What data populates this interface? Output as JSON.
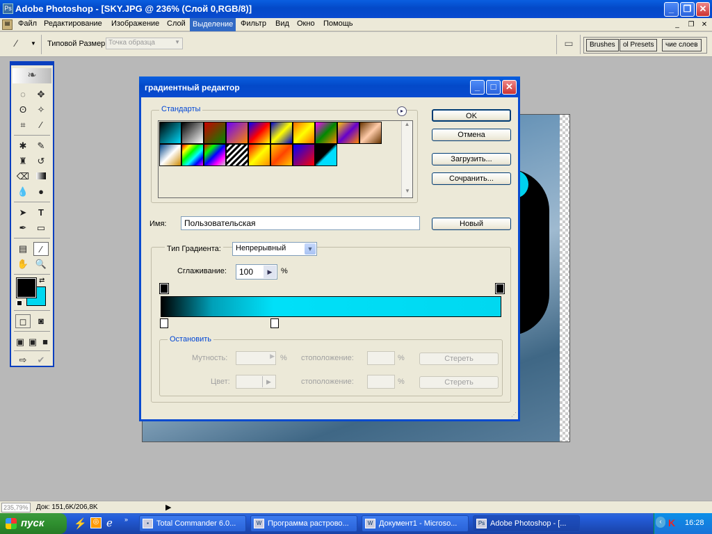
{
  "window": {
    "title": "Adobe Photoshop - [SKY.JPG @ 236% (Слой 0,RGB/8)]",
    "app_icon": "photoshop-icon"
  },
  "menu": [
    "Файл",
    "Редактирование",
    "Изображение",
    "Слой",
    "Выделение",
    "Фильтр",
    "Вид",
    "Окно",
    "Помощь"
  ],
  "menu_selected": "Выделение",
  "options_bar": {
    "label": "Типовой Размер:",
    "sample_value": "Точка образца",
    "palette_tabs": [
      "Brushes",
      "ol Presets",
      "чие слоев"
    ]
  },
  "dialog": {
    "title": "градиентный редактор",
    "presets_label": "Стандарты",
    "buttons": {
      "ok": "OK",
      "cancel": "Отмена",
      "load": "Загрузить...",
      "save": "Сочранить...",
      "new": "Новый"
    },
    "name_label": "Имя:",
    "name_value": "Пользовательская",
    "gradient_type_label": "Тип Градиента:",
    "gradient_type_value": "Непрерывный",
    "smoothness_label": "Сглаживание:",
    "smoothness_value": "100",
    "percent": "%",
    "stops_label": "Остановить",
    "opacity_label": "Мутность:",
    "location_label": "стоположение:",
    "color_label": "Цвет:",
    "delete_label": "Стереть",
    "gradient_colors": [
      "#000000",
      "#00a0b8",
      "#00e0f8",
      "#00d8f0"
    ]
  },
  "presets": [
    "linear-gradient(135deg,#000,#00d8f8)",
    "linear-gradient(135deg,#000,#fff)",
    "linear-gradient(135deg,#c00,#080)",
    "linear-gradient(135deg,#60f,#f80)",
    "linear-gradient(135deg,#00f,#f00,#ff0)",
    "linear-gradient(135deg,#00c,#ff0,#00c)",
    "linear-gradient(135deg,#f60,#ff0,#f60)",
    "linear-gradient(135deg,#f0f,#080,#f80)",
    "linear-gradient(135deg,#fc0,#60c,#f80)",
    "linear-gradient(135deg,#630,#fca,#630)",
    "linear-gradient(135deg,#048,#fff,#c80)",
    "linear-gradient(135deg,#f00,#ff0,#0f0,#0ff,#00f,#f0f)",
    "linear-gradient(135deg,#f00,#0f0,#00f,#f0f,#ccc)",
    "repeating-linear-gradient(135deg,#000 0 3px,#fff 3px 6px)",
    "linear-gradient(135deg,#f00,#ff0,#f80)",
    "linear-gradient(135deg,#fc0,#f40,#fc0)",
    "linear-gradient(135deg,#00f,#f00)",
    "linear-gradient(135deg,#000 45%,#0df 55%)"
  ],
  "status": {
    "zoom": "235,79%",
    "doc": "Док: 151,6K/206,8K"
  },
  "taskbar": {
    "start": "пуск",
    "tasks": [
      "Total Commander 6.0...",
      "Программа растрово...",
      "Документ1 - Microso...",
      "Adobe Photoshop - [..."
    ],
    "active_task": "Adobe Photoshop - [...",
    "time": "16:28"
  }
}
